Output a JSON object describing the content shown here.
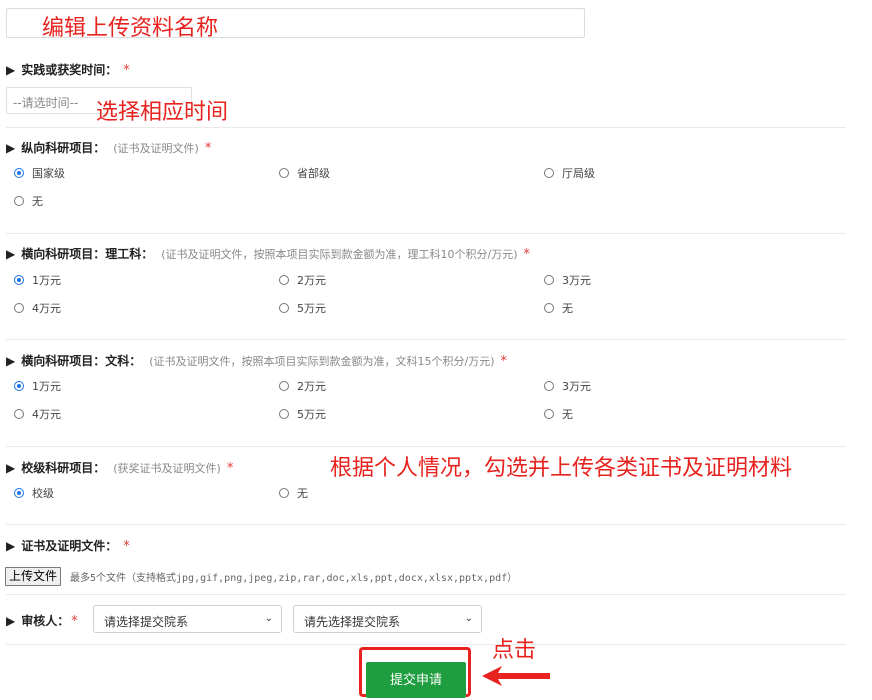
{
  "annotations": {
    "edit_title": "编辑上传资料名称",
    "choose_time": "选择相应时间",
    "check_and_upload": "根据个人情况，勾选并上传各类证书及证明材料",
    "click": "点击"
  },
  "time_section": {
    "label": "实践或获奖时间：",
    "required_mark": "*",
    "placeholder": "--请选时间--"
  },
  "vertical_project": {
    "label": "纵向科研项目：",
    "hint": "(证书及证明文件)",
    "required_mark": "*",
    "options": [
      "国家级",
      "省部级",
      "厅局级",
      "无"
    ],
    "selected": "国家级"
  },
  "horizontal_sci": {
    "label": "横向科研项目：理工科：",
    "hint": "(证书及证明文件，按照本项目实际到款金额为准，理工科10个积分/万元)",
    "required_mark": "*",
    "options": [
      "1万元",
      "2万元",
      "3万元",
      "4万元",
      "5万元",
      "无"
    ],
    "selected": "1万元"
  },
  "horizontal_arts": {
    "label": "横向科研项目：文科：",
    "hint": "(证书及证明文件，按照本项目实际到款金额为准，文科15个积分/万元)",
    "required_mark": "*",
    "options": [
      "1万元",
      "2万元",
      "3万元",
      "4万元",
      "5万元",
      "无"
    ],
    "selected": "1万元"
  },
  "school_project": {
    "label": "校级科研项目：",
    "hint": "(获奖证书及证明文件)",
    "required_mark": "*",
    "options": [
      "校级",
      "无"
    ],
    "selected": "校级"
  },
  "files": {
    "label": "证书及证明文件：",
    "required_mark": "*",
    "upload_button": "上传文件",
    "upload_hint": "最多5个文件（支持格式jpg,gif,png,jpeg,zip,rar,doc,xls,ppt,docx,xlsx,pptx,pdf）"
  },
  "reviewer": {
    "label": "审核人：",
    "required_mark": "*",
    "select_college": "请选择提交院系",
    "select_reviewer": "请先选择提交院系"
  },
  "submit": {
    "label": "提交申请"
  },
  "icons": {
    "section_marker": "triangle-right-icon",
    "dropdown": "chevron-down-icon"
  },
  "colors": {
    "annotation": "#e8231f",
    "submit": "#1e9e3e",
    "radio_checked": "#1a73e8",
    "required": "#e53935"
  }
}
